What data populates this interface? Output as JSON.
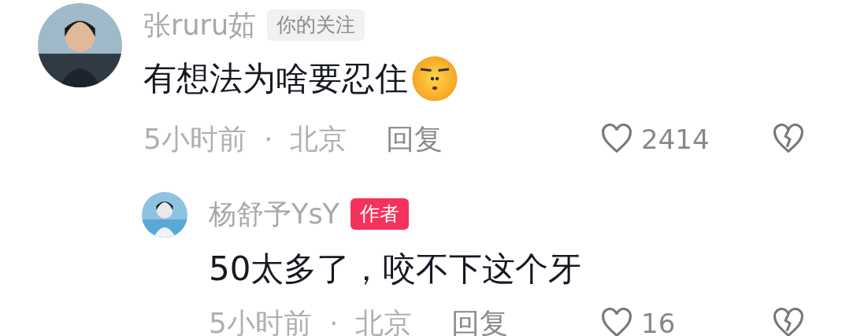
{
  "comments": [
    {
      "author": "张ruru茹",
      "tag": {
        "kind": "follow",
        "text": "你的关注"
      },
      "text": "有想法为啥要忍住",
      "emoji": true,
      "time": "5小时前",
      "separator": "·",
      "location": "北京",
      "reply_label": "回复",
      "likes": "2414",
      "children": [
        {
          "author": "杨舒予YsY",
          "tag": {
            "kind": "author",
            "text": "作者"
          },
          "text": "50太多了，咬不下这个牙",
          "emoji": false,
          "time": "5小时前",
          "separator": "·",
          "location": "北京",
          "reply_label": "回复",
          "likes": "16"
        }
      ]
    }
  ]
}
